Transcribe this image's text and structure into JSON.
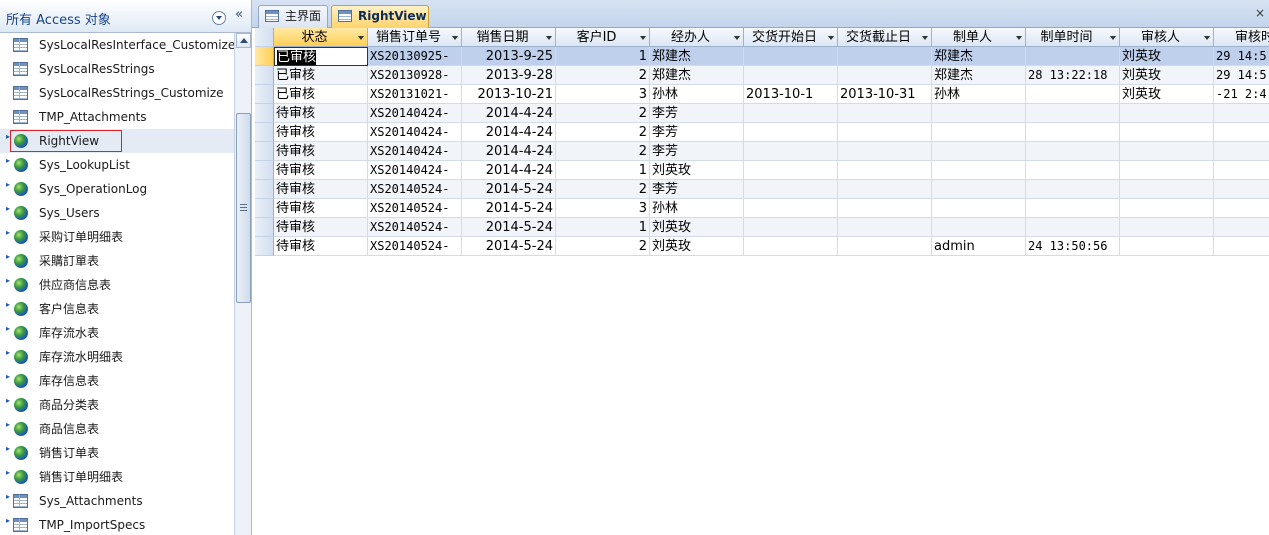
{
  "nav": {
    "title": "所有 Access 对象",
    "dropdown_icon": "chevron-down-icon",
    "collapse_label": "«",
    "items": [
      {
        "label": "SysLocalResInterface_Customize",
        "icon": "table",
        "link": false
      },
      {
        "label": "SysLocalResStrings",
        "icon": "table",
        "link": false
      },
      {
        "label": "SysLocalResStrings_Customize",
        "icon": "table",
        "link": false
      },
      {
        "label": "TMP_Attachments",
        "icon": "table",
        "link": false
      },
      {
        "label": "RightView",
        "icon": "globe",
        "link": true,
        "selected": true
      },
      {
        "label": "Sys_LookupList",
        "icon": "globe",
        "link": true
      },
      {
        "label": "Sys_OperationLog",
        "icon": "globe",
        "link": true
      },
      {
        "label": "Sys_Users",
        "icon": "globe",
        "link": true
      },
      {
        "label": "采购订单明细表",
        "icon": "globe",
        "link": true
      },
      {
        "label": "采購訂單表",
        "icon": "globe",
        "link": true
      },
      {
        "label": "供应商信息表",
        "icon": "globe",
        "link": true
      },
      {
        "label": "客户信息表",
        "icon": "globe",
        "link": true
      },
      {
        "label": "库存流水表",
        "icon": "globe",
        "link": true
      },
      {
        "label": "库存流水明细表",
        "icon": "globe",
        "link": true
      },
      {
        "label": "库存信息表",
        "icon": "globe",
        "link": true
      },
      {
        "label": "商品分类表",
        "icon": "globe",
        "link": true
      },
      {
        "label": "商品信息表",
        "icon": "globe",
        "link": true
      },
      {
        "label": "销售订单表",
        "icon": "globe",
        "link": true
      },
      {
        "label": "销售订单明细表",
        "icon": "globe",
        "link": true
      },
      {
        "label": "Sys_Attachments",
        "icon": "table",
        "link": true
      },
      {
        "label": "TMP_ImportSpecs",
        "icon": "table",
        "link": true
      }
    ]
  },
  "tabs": [
    {
      "label": "主界面",
      "active": false
    },
    {
      "label": "RightView",
      "active": true
    }
  ],
  "close_label": "×",
  "grid": {
    "columns": [
      "状态",
      "销售订单号",
      "销售日期",
      "客户ID",
      "经办人",
      "交货开始日",
      "交货截止日",
      "制单人",
      "制单时间",
      "审核人",
      "审核时"
    ],
    "rows": [
      [
        "已审核",
        "XS20130925-",
        "2013-9-25",
        "1",
        "郑建杰",
        "",
        "",
        "郑建杰",
        "",
        "刘英玫",
        "29 14:5"
      ],
      [
        "已审核",
        "XS20130928-",
        "2013-9-28",
        "2",
        "郑建杰",
        "",
        "",
        "郑建杰",
        "28 13:22:18",
        "刘英玫",
        "29 14:5"
      ],
      [
        "已审核",
        "XS20131021-",
        "2013-10-21",
        "3",
        "孙林",
        "2013-10-1",
        "2013-10-31",
        "孙林",
        "",
        "刘英玫",
        "-21 2:4"
      ],
      [
        "待审核",
        "XS20140424-",
        "2014-4-24",
        "2",
        "李芳",
        "",
        "",
        "",
        "",
        "",
        ""
      ],
      [
        "待审核",
        "XS20140424-",
        "2014-4-24",
        "2",
        "李芳",
        "",
        "",
        "",
        "",
        "",
        ""
      ],
      [
        "待审核",
        "XS20140424-",
        "2014-4-24",
        "2",
        "李芳",
        "",
        "",
        "",
        "",
        "",
        ""
      ],
      [
        "待审核",
        "XS20140424-",
        "2014-4-24",
        "1",
        "刘英玫",
        "",
        "",
        "",
        "",
        "",
        ""
      ],
      [
        "待审核",
        "XS20140524-",
        "2014-5-24",
        "2",
        "李芳",
        "",
        "",
        "",
        "",
        "",
        ""
      ],
      [
        "待审核",
        "XS20140524-",
        "2014-5-24",
        "3",
        "孙林",
        "",
        "",
        "",
        "",
        "",
        ""
      ],
      [
        "待审核",
        "XS20140524-",
        "2014-5-24",
        "1",
        "刘英玫",
        "",
        "",
        "",
        "",
        "",
        ""
      ],
      [
        "待审核",
        "XS20140524-",
        "2014-5-24",
        "2",
        "刘英玫",
        "",
        "",
        "admin",
        "24 13:50:56",
        "",
        ""
      ]
    ]
  }
}
